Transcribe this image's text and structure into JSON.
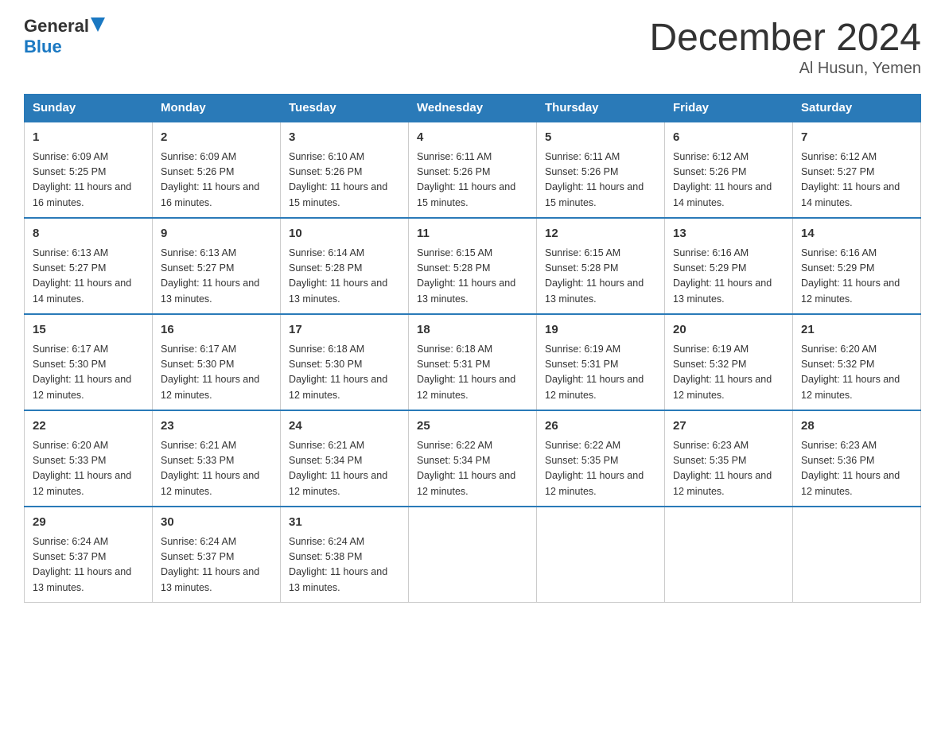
{
  "header": {
    "logo_general": "General",
    "logo_blue": "Blue",
    "month_title": "December 2024",
    "location": "Al Husun, Yemen"
  },
  "days_of_week": [
    "Sunday",
    "Monday",
    "Tuesday",
    "Wednesday",
    "Thursday",
    "Friday",
    "Saturday"
  ],
  "weeks": [
    [
      {
        "day": "1",
        "sunrise": "6:09 AM",
        "sunset": "5:25 PM",
        "daylight": "11 hours and 16 minutes."
      },
      {
        "day": "2",
        "sunrise": "6:09 AM",
        "sunset": "5:26 PM",
        "daylight": "11 hours and 16 minutes."
      },
      {
        "day": "3",
        "sunrise": "6:10 AM",
        "sunset": "5:26 PM",
        "daylight": "11 hours and 15 minutes."
      },
      {
        "day": "4",
        "sunrise": "6:11 AM",
        "sunset": "5:26 PM",
        "daylight": "11 hours and 15 minutes."
      },
      {
        "day": "5",
        "sunrise": "6:11 AM",
        "sunset": "5:26 PM",
        "daylight": "11 hours and 15 minutes."
      },
      {
        "day": "6",
        "sunrise": "6:12 AM",
        "sunset": "5:26 PM",
        "daylight": "11 hours and 14 minutes."
      },
      {
        "day": "7",
        "sunrise": "6:12 AM",
        "sunset": "5:27 PM",
        "daylight": "11 hours and 14 minutes."
      }
    ],
    [
      {
        "day": "8",
        "sunrise": "6:13 AM",
        "sunset": "5:27 PM",
        "daylight": "11 hours and 14 minutes."
      },
      {
        "day": "9",
        "sunrise": "6:13 AM",
        "sunset": "5:27 PM",
        "daylight": "11 hours and 13 minutes."
      },
      {
        "day": "10",
        "sunrise": "6:14 AM",
        "sunset": "5:28 PM",
        "daylight": "11 hours and 13 minutes."
      },
      {
        "day": "11",
        "sunrise": "6:15 AM",
        "sunset": "5:28 PM",
        "daylight": "11 hours and 13 minutes."
      },
      {
        "day": "12",
        "sunrise": "6:15 AM",
        "sunset": "5:28 PM",
        "daylight": "11 hours and 13 minutes."
      },
      {
        "day": "13",
        "sunrise": "6:16 AM",
        "sunset": "5:29 PM",
        "daylight": "11 hours and 13 minutes."
      },
      {
        "day": "14",
        "sunrise": "6:16 AM",
        "sunset": "5:29 PM",
        "daylight": "11 hours and 12 minutes."
      }
    ],
    [
      {
        "day": "15",
        "sunrise": "6:17 AM",
        "sunset": "5:30 PM",
        "daylight": "11 hours and 12 minutes."
      },
      {
        "day": "16",
        "sunrise": "6:17 AM",
        "sunset": "5:30 PM",
        "daylight": "11 hours and 12 minutes."
      },
      {
        "day": "17",
        "sunrise": "6:18 AM",
        "sunset": "5:30 PM",
        "daylight": "11 hours and 12 minutes."
      },
      {
        "day": "18",
        "sunrise": "6:18 AM",
        "sunset": "5:31 PM",
        "daylight": "11 hours and 12 minutes."
      },
      {
        "day": "19",
        "sunrise": "6:19 AM",
        "sunset": "5:31 PM",
        "daylight": "11 hours and 12 minutes."
      },
      {
        "day": "20",
        "sunrise": "6:19 AM",
        "sunset": "5:32 PM",
        "daylight": "11 hours and 12 minutes."
      },
      {
        "day": "21",
        "sunrise": "6:20 AM",
        "sunset": "5:32 PM",
        "daylight": "11 hours and 12 minutes."
      }
    ],
    [
      {
        "day": "22",
        "sunrise": "6:20 AM",
        "sunset": "5:33 PM",
        "daylight": "11 hours and 12 minutes."
      },
      {
        "day": "23",
        "sunrise": "6:21 AM",
        "sunset": "5:33 PM",
        "daylight": "11 hours and 12 minutes."
      },
      {
        "day": "24",
        "sunrise": "6:21 AM",
        "sunset": "5:34 PM",
        "daylight": "11 hours and 12 minutes."
      },
      {
        "day": "25",
        "sunrise": "6:22 AM",
        "sunset": "5:34 PM",
        "daylight": "11 hours and 12 minutes."
      },
      {
        "day": "26",
        "sunrise": "6:22 AM",
        "sunset": "5:35 PM",
        "daylight": "11 hours and 12 minutes."
      },
      {
        "day": "27",
        "sunrise": "6:23 AM",
        "sunset": "5:35 PM",
        "daylight": "11 hours and 12 minutes."
      },
      {
        "day": "28",
        "sunrise": "6:23 AM",
        "sunset": "5:36 PM",
        "daylight": "11 hours and 12 minutes."
      }
    ],
    [
      {
        "day": "29",
        "sunrise": "6:24 AM",
        "sunset": "5:37 PM",
        "daylight": "11 hours and 13 minutes."
      },
      {
        "day": "30",
        "sunrise": "6:24 AM",
        "sunset": "5:37 PM",
        "daylight": "11 hours and 13 minutes."
      },
      {
        "day": "31",
        "sunrise": "6:24 AM",
        "sunset": "5:38 PM",
        "daylight": "11 hours and 13 minutes."
      },
      null,
      null,
      null,
      null
    ]
  ]
}
